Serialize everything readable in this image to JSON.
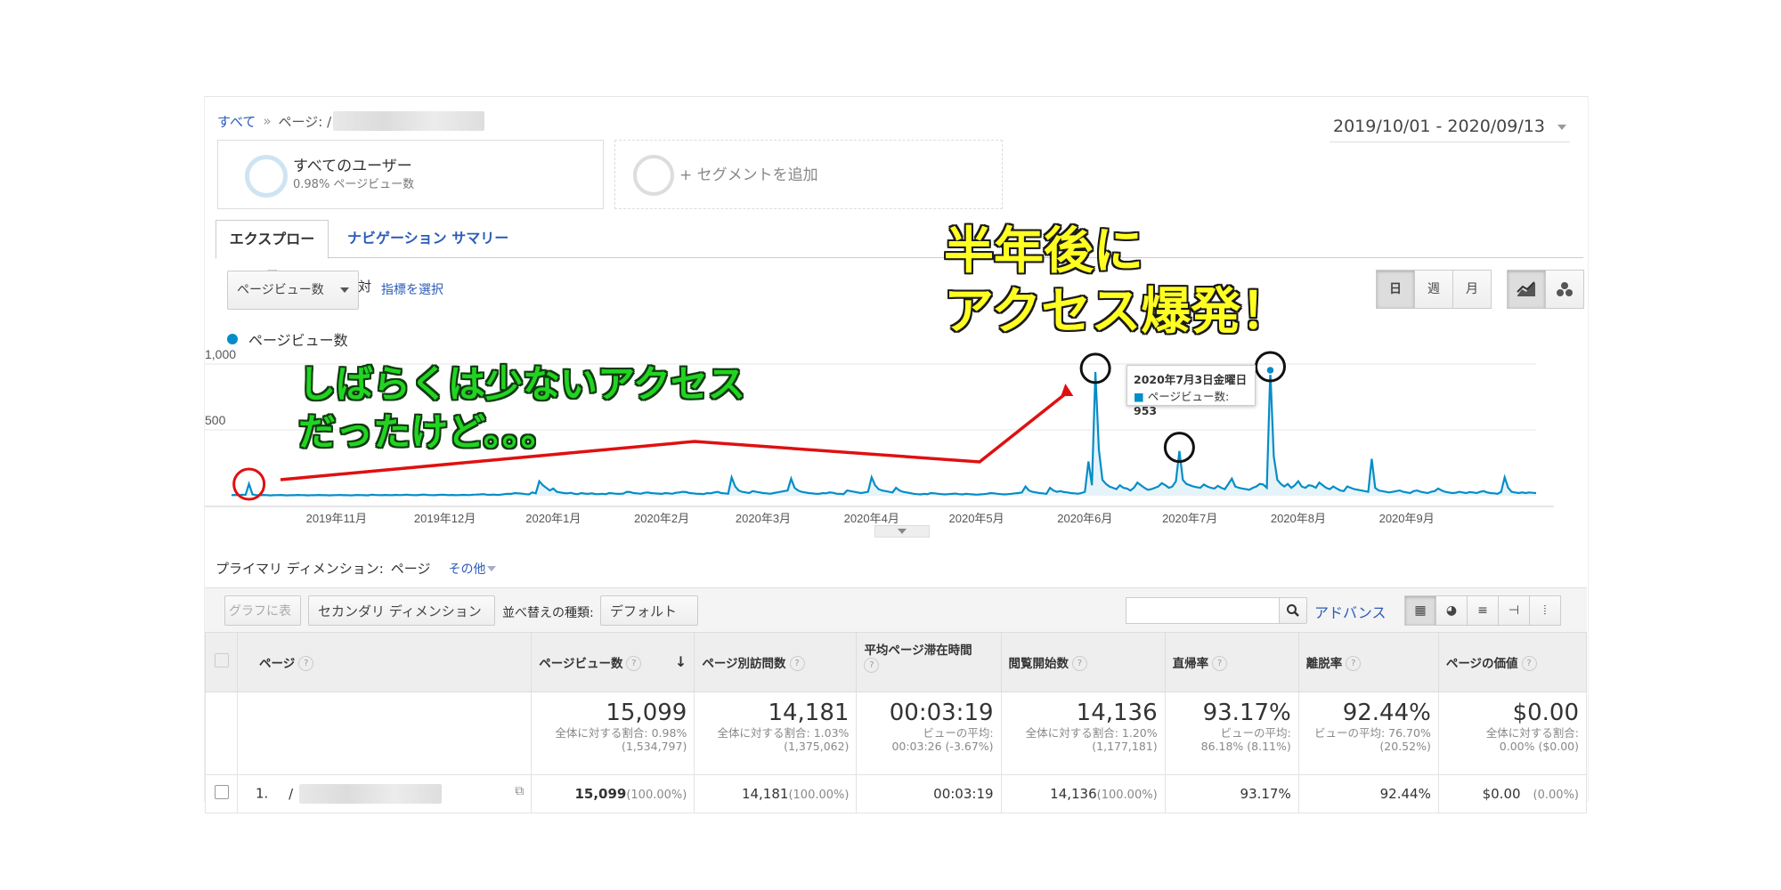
{
  "breadcrumb": {
    "root": "すべて",
    "sep": "»",
    "page_prefix": "ページ: /"
  },
  "date_range": "2019/10/01 - 2020/09/13",
  "segments": [
    {
      "name": "すべてのユーザー",
      "detail": "0.98% ページビュー数"
    },
    {
      "name": "+ セグメントを追加"
    }
  ],
  "tabs": [
    "エクスプローラ",
    "ナビゲーション サマリー"
  ],
  "metric": {
    "selected": "ページビュー数",
    "vs": "対",
    "choose": "指標を選択"
  },
  "granularity": [
    "日",
    "週",
    "月"
  ],
  "legend": "ページビュー数",
  "annotations": {
    "left": [
      "しばらくは少ないアクセス",
      "だったけど。。。"
    ],
    "right": [
      "半年後に",
      "アクセス爆発！"
    ]
  },
  "tooltip": {
    "date": "2020年7月3日金曜日",
    "label": "ページビュー数:",
    "value": "953"
  },
  "chart_data": {
    "type": "line",
    "yticks": [
      "1,000",
      "500"
    ],
    "ylim": [
      0,
      1000
    ],
    "xticks": [
      "2019年11月",
      "2019年12月",
      "2020年1月",
      "2020年2月",
      "2020年3月",
      "2020年4月",
      "2020年5月",
      "2020年6月",
      "2020年7月",
      "2020年8月",
      "2020年9月"
    ],
    "series": [
      {
        "name": "ページビュー数",
        "color": "#058dc7",
        "values": [
          5,
          6,
          4,
          8,
          6,
          90,
          10,
          5,
          4,
          6,
          5,
          3,
          4,
          5,
          6,
          4,
          3,
          5,
          4,
          6,
          5,
          4,
          3,
          5,
          4,
          6,
          4,
          5,
          3,
          4,
          5,
          6,
          4,
          5,
          3,
          4,
          6,
          5,
          4,
          3,
          8,
          6,
          5,
          4,
          6,
          5,
          4,
          7,
          5,
          6,
          8,
          6,
          5,
          4,
          7,
          9,
          6,
          5,
          4,
          6,
          8,
          7,
          5,
          6,
          4,
          5,
          7,
          6,
          5,
          8,
          9,
          10,
          12,
          8,
          7,
          9,
          6,
          8,
          12,
          15,
          14,
          20,
          18,
          16,
          12,
          10,
          25,
          18,
          110,
          80,
          60,
          40,
          55,
          30,
          25,
          20,
          18,
          22,
          15,
          12,
          20,
          16,
          14,
          18,
          13,
          12,
          15,
          12,
          20,
          18,
          15,
          14,
          16,
          30,
          28,
          20,
          18,
          15,
          22,
          25,
          20,
          18,
          16,
          14,
          20,
          18,
          15,
          22,
          25,
          30,
          28,
          20,
          18,
          15,
          14,
          12,
          20,
          18,
          25,
          30,
          20,
          18,
          15,
          140,
          70,
          40,
          30,
          25,
          20,
          35,
          30,
          25,
          20,
          18,
          15,
          20,
          25,
          30,
          35,
          40,
          130,
          60,
          40,
          30,
          25,
          20,
          18,
          15,
          14,
          20,
          18,
          25,
          22,
          15,
          14,
          12,
          40,
          35,
          30,
          25,
          20,
          25,
          30,
          140,
          80,
          50,
          40,
          35,
          30,
          25,
          60,
          40,
          30,
          25,
          20,
          15,
          12,
          10,
          14,
          12,
          20,
          18,
          15,
          12,
          10,
          12,
          14,
          16,
          12,
          10,
          15,
          12,
          10,
          8,
          10,
          12,
          15,
          20,
          18,
          15,
          12,
          10,
          12,
          15,
          18,
          20,
          25,
          70,
          40,
          30,
          25,
          20,
          18,
          14,
          60,
          40,
          30,
          35,
          28,
          25,
          20,
          18,
          15,
          20,
          30,
          260,
          80,
          940,
          350,
          120,
          90,
          70,
          60,
          50,
          80,
          60,
          55,
          40,
          60,
          100,
          80,
          60,
          45,
          50,
          60,
          70,
          95,
          80,
          60,
          70,
          110,
          340,
          120,
          90,
          80,
          70,
          65,
          60,
          85,
          70,
          60,
          55,
          75,
          60,
          50,
          90,
          130,
          70,
          60,
          55,
          50,
          45,
          60,
          70,
          90,
          85,
          60,
          953,
          300,
          120,
          90,
          70,
          90,
          60,
          80,
          110,
          70,
          60,
          80,
          75,
          60,
          100,
          80,
          60,
          50,
          70,
          55,
          40,
          35,
          70,
          60,
          50,
          45,
          40,
          35,
          30,
          280,
          60,
          40,
          35,
          30,
          25,
          30,
          35,
          40,
          30,
          25,
          20,
          35,
          40,
          30,
          25,
          20,
          30,
          35,
          55,
          40,
          30,
          25,
          20,
          22,
          30,
          25,
          20,
          28,
          25,
          20,
          30,
          35,
          25,
          20,
          18,
          15,
          30,
          140,
          60,
          30,
          25,
          20,
          25,
          20,
          25,
          22,
          20
        ]
      }
    ]
  },
  "primary_dim": {
    "label": "プライマリ ディメンション:",
    "value": "ページ",
    "other": "その他"
  },
  "toolbar": {
    "plot": "グラフに表示",
    "secondary": "セカンダリ ディメンション",
    "sort_label": "並べ替えの種類:",
    "sort": "デフォルト",
    "advanced": "アドバンス"
  },
  "table": {
    "headers": [
      "ページ",
      "ページビュー数",
      "ページ別訪問数",
      "平均ページ滞在時間",
      "閲覧開始数",
      "直帰率",
      "離脱率",
      "ページの価値"
    ],
    "totals": [
      {
        "v": "15,099",
        "s1": "全体に対する割合: 0.98%",
        "s2": "(1,534,797)"
      },
      {
        "v": "14,181",
        "s1": "全体に対する割合: 1.03%",
        "s2": "(1,375,062)"
      },
      {
        "v": "00:03:19",
        "s1": "ビューの平均:",
        "s2": "00:03:26 (-3.67%)"
      },
      {
        "v": "14,136",
        "s1": "全体に対する割合: 1.20%",
        "s2": "(1,177,181)"
      },
      {
        "v": "93.17%",
        "s1": "ビューの平均:",
        "s2": "86.18% (8.11%)"
      },
      {
        "v": "92.44%",
        "s1": "ビューの平均: 76.70%",
        "s2": "(20.52%)"
      },
      {
        "v": "$0.00",
        "s1": "全体に対する割合:",
        "s2": "0.00% ($0.00)"
      }
    ],
    "row": {
      "index": "1.",
      "path": "/",
      "pv": "15,099",
      "pv_pct": "(100.00%)",
      "upv": "14,181",
      "upv_pct": "(100.00%)",
      "time": "00:03:19",
      "entr": "14,136",
      "entr_pct": "(100.00%)",
      "bounce": "93.17%",
      "exit": "92.44%",
      "value": "$0.00",
      "value_pct": "(0.00%)"
    }
  }
}
